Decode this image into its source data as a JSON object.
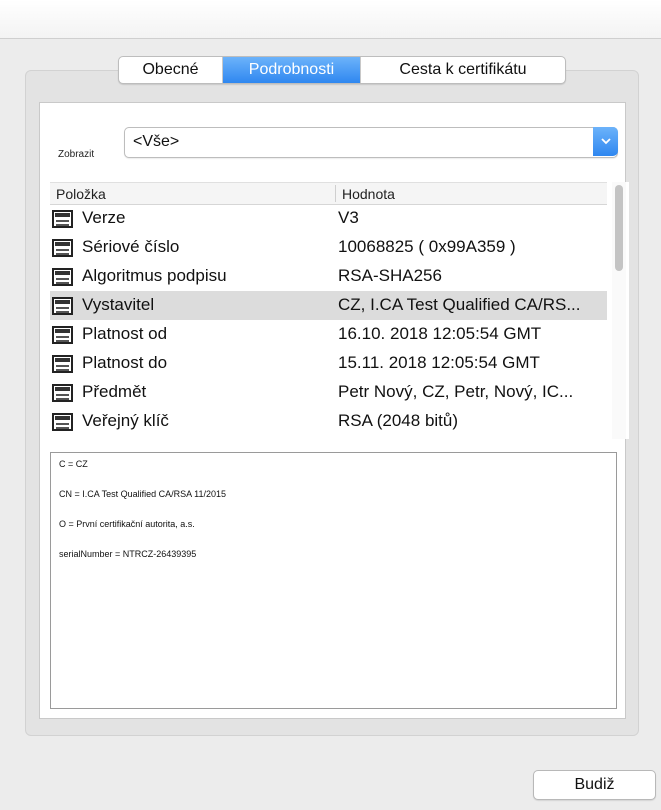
{
  "tabs": [
    {
      "label": "Obecné",
      "active": false
    },
    {
      "label": "Podrobnosti",
      "active": true
    },
    {
      "label": "Cesta k certifikátu",
      "active": false
    }
  ],
  "filter": {
    "label": "Zobrazit",
    "selected": "<Vše>"
  },
  "table": {
    "columns": [
      "Položka",
      "Hodnota"
    ],
    "rows": [
      {
        "field": "Verze",
        "value": "V3"
      },
      {
        "field": "Sériové číslo",
        "value": "10068825 ( 0x99A359 )"
      },
      {
        "field": "Algoritmus podpisu",
        "value": "RSA-SHA256"
      },
      {
        "field": "Vystavitel",
        "value": "CZ, I.CA Test Qualified CA/RS...",
        "selected": true
      },
      {
        "field": "Platnost od",
        "value": "16.10. 2018 12:05:54 GMT"
      },
      {
        "field": "Platnost do",
        "value": "15.11. 2018 12:05:54 GMT"
      },
      {
        "field": "Předmět",
        "value": "Petr Nový, CZ, Petr, Nový, IC..."
      },
      {
        "field": "Veřejný klíč",
        "value": "RSA (2048 bitů)"
      }
    ]
  },
  "details": {
    "lines": [
      "C = CZ",
      "CN = I.CA Test Qualified CA/RSA 11/2015",
      "O = První certifikační autorita, a.s.",
      "serialNumber = NTRCZ-26439395"
    ]
  },
  "footer": {
    "ok_label": "Budiž"
  },
  "colors": {
    "accent": "#2f87f0",
    "selected_row": "#dcdcdc"
  }
}
